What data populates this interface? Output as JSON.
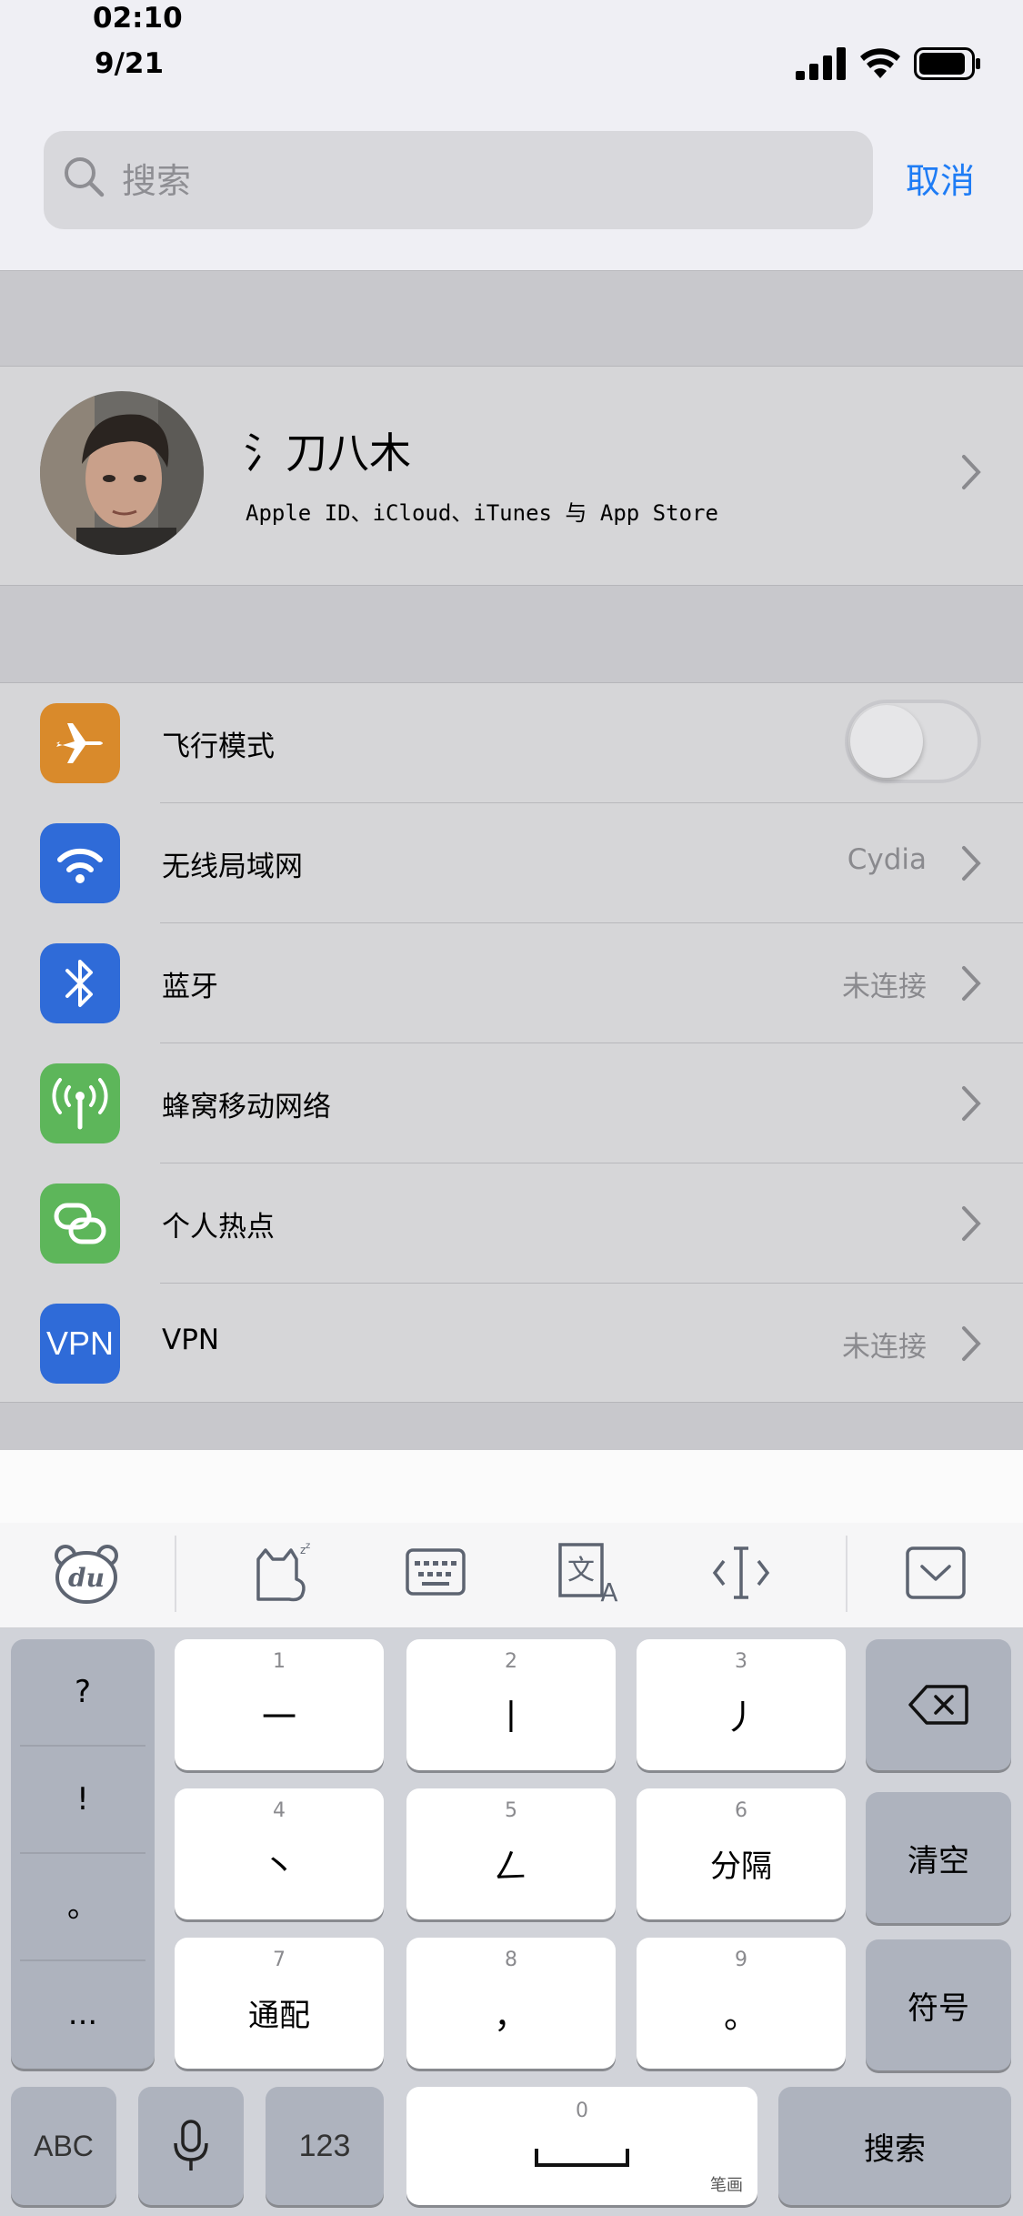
{
  "status_bar": {
    "time": "02:10",
    "date": "9/21"
  },
  "search": {
    "placeholder": "搜索",
    "cancel_label": "取消"
  },
  "profile": {
    "name": "氵刀八木",
    "subtitle": "Apple ID、iCloud、iTunes 与 App Store"
  },
  "settings": {
    "rows": [
      {
        "label": "飞行模式",
        "value": "",
        "icon": "airplane-icon",
        "color": "#d98a2b",
        "toggle_on": false
      },
      {
        "label": "无线局域网",
        "value": "Cydia",
        "icon": "wifi-icon",
        "color": "#2f6bd8"
      },
      {
        "label": "蓝牙",
        "value": "未连接",
        "icon": "bluetooth-icon",
        "color": "#2f6bd8"
      },
      {
        "label": "蜂窝移动网络",
        "value": "",
        "icon": "antenna-icon",
        "color": "#5db65a"
      },
      {
        "label": "个人热点",
        "value": "",
        "icon": "link-icon",
        "color": "#5db65a"
      },
      {
        "label": "VPN",
        "value": "未连接",
        "icon": "vpn-icon",
        "icon_text": "VPN",
        "color": "#2f6bd8"
      }
    ]
  },
  "keyboard": {
    "toolbar": [
      "du-logo-icon",
      "emoji-cat-icon",
      "keyboard-icon",
      "translate-icon",
      "cursor-icon",
      "dismiss-keyboard-icon"
    ],
    "punctuation": [
      "?",
      "!",
      "。",
      "..."
    ],
    "stroke_keys": [
      {
        "num": "1",
        "label": "一"
      },
      {
        "num": "2",
        "label": "丨"
      },
      {
        "num": "3",
        "label": "丿"
      },
      {
        "num": "4",
        "label": "丶"
      },
      {
        "num": "5",
        "label": "𠃋"
      },
      {
        "num": "6",
        "label": "分隔"
      },
      {
        "num": "7",
        "label": "通配"
      },
      {
        "num": "8",
        "label": "，"
      },
      {
        "num": "9",
        "label": "。"
      }
    ],
    "clear_label": "清空",
    "symbol_label": "符号",
    "abc_label": "ABC",
    "num_label": "123",
    "space_num": "0",
    "space_sub": "笔画",
    "search_label": "搜索"
  }
}
